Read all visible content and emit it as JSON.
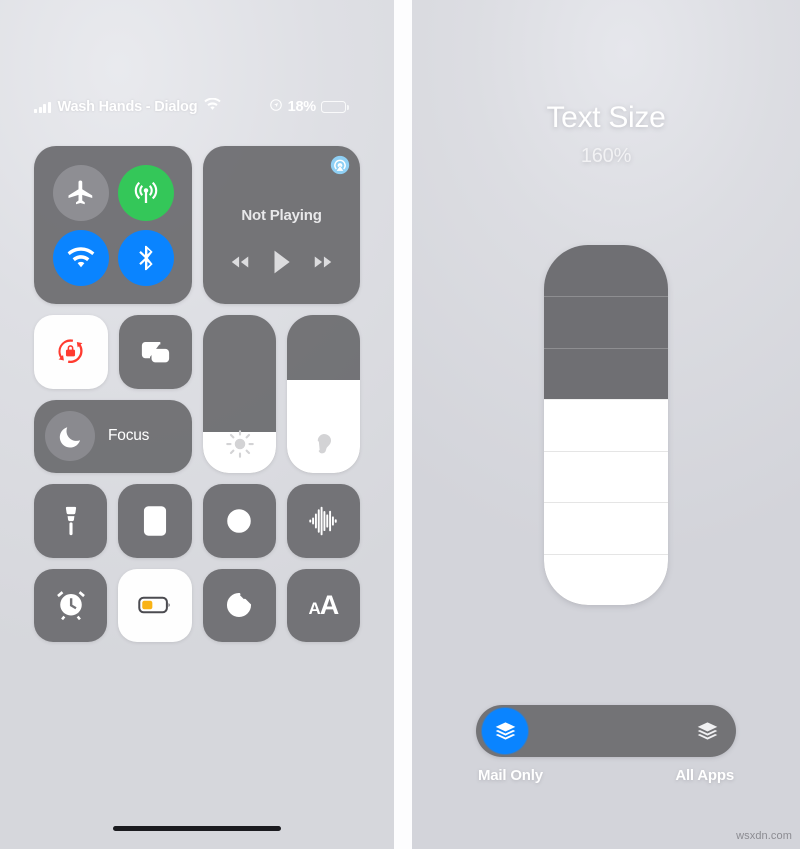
{
  "left_panel": {
    "status_bar": {
      "carrier": "Wash Hands - Dialog",
      "signal_icon": "cellular-bars-icon",
      "wifi_icon": "wifi-icon",
      "location_icon": "location-services-icon",
      "battery_percent": "18%",
      "battery_icon": "battery-low-power-icon",
      "battery_fill_color": "#f9c22e",
      "battery_level": 18
    },
    "connectivity": {
      "airplane": {
        "label": "Airplane Mode",
        "icon": "airplane-icon",
        "state": "off",
        "color": "#8e8e93"
      },
      "cellular": {
        "label": "Cellular Data",
        "icon": "cellular-antenna-icon",
        "state": "on",
        "color": "#34c759"
      },
      "wifi": {
        "label": "Wi-Fi",
        "icon": "wifi-icon",
        "state": "on",
        "color": "#0a84ff"
      },
      "bluetooth": {
        "label": "Bluetooth",
        "icon": "bluetooth-icon",
        "state": "on",
        "color": "#0a84ff"
      }
    },
    "media": {
      "title": "Not Playing",
      "airplay_icon": "airplay-audio-icon",
      "rewind_icon": "rewind-icon",
      "play_icon": "play-icon",
      "forward_icon": "fast-forward-icon"
    },
    "tiles": {
      "rotation_lock": {
        "label": "Rotation Lock",
        "icon": "rotation-lock-icon",
        "state": "on",
        "icon_color": "#ff3b30"
      },
      "screen_mirroring": {
        "label": "Screen Mirroring",
        "icon": "screen-mirroring-icon",
        "state": "off"
      },
      "focus": {
        "label": "Focus",
        "icon": "moon-icon",
        "state": "off"
      }
    },
    "sliders": {
      "brightness": {
        "label": "Brightness",
        "icon": "brightness-sun-icon",
        "value": 26
      },
      "volume": {
        "label": "Volume",
        "icon": "hearing-ear-icon",
        "value": 59
      }
    },
    "bottom_grid": [
      {
        "label": "Flashlight",
        "icon": "flashlight-icon",
        "state": "off"
      },
      {
        "label": "Calculator",
        "icon": "calculator-icon",
        "state": "off"
      },
      {
        "label": "Camera",
        "icon": "camera-icon",
        "state": "off"
      },
      {
        "label": "Sound Recognition",
        "icon": "sound-waveform-icon",
        "state": "off"
      },
      {
        "label": "Alarm",
        "icon": "alarm-clock-icon",
        "state": "off"
      },
      {
        "label": "Low Power Mode",
        "icon": "battery-icon",
        "state": "on"
      },
      {
        "label": "Timer",
        "icon": "timer-icon",
        "state": "off"
      },
      {
        "label": "Text Size",
        "icon": "text-size-aa-icon",
        "state": "off",
        "glyph_small": "A",
        "glyph_large": "A"
      }
    ],
    "home_indicator": "home-indicator"
  },
  "right_panel": {
    "title": "Text Size",
    "percent": "160%",
    "slider": {
      "segments": 7,
      "filled_from_bottom": 4,
      "fill_color": "#ffffff",
      "track_color": "#6f6f73"
    },
    "scope_toggle": {
      "left_option": {
        "label": "Mail Only",
        "icon": "layers-stack-icon",
        "selected": true,
        "color": "#0a84ff"
      },
      "right_option": {
        "label": "All Apps",
        "icon": "layers-stack-icon",
        "selected": false
      }
    }
  },
  "watermark": "wsxdn.com"
}
